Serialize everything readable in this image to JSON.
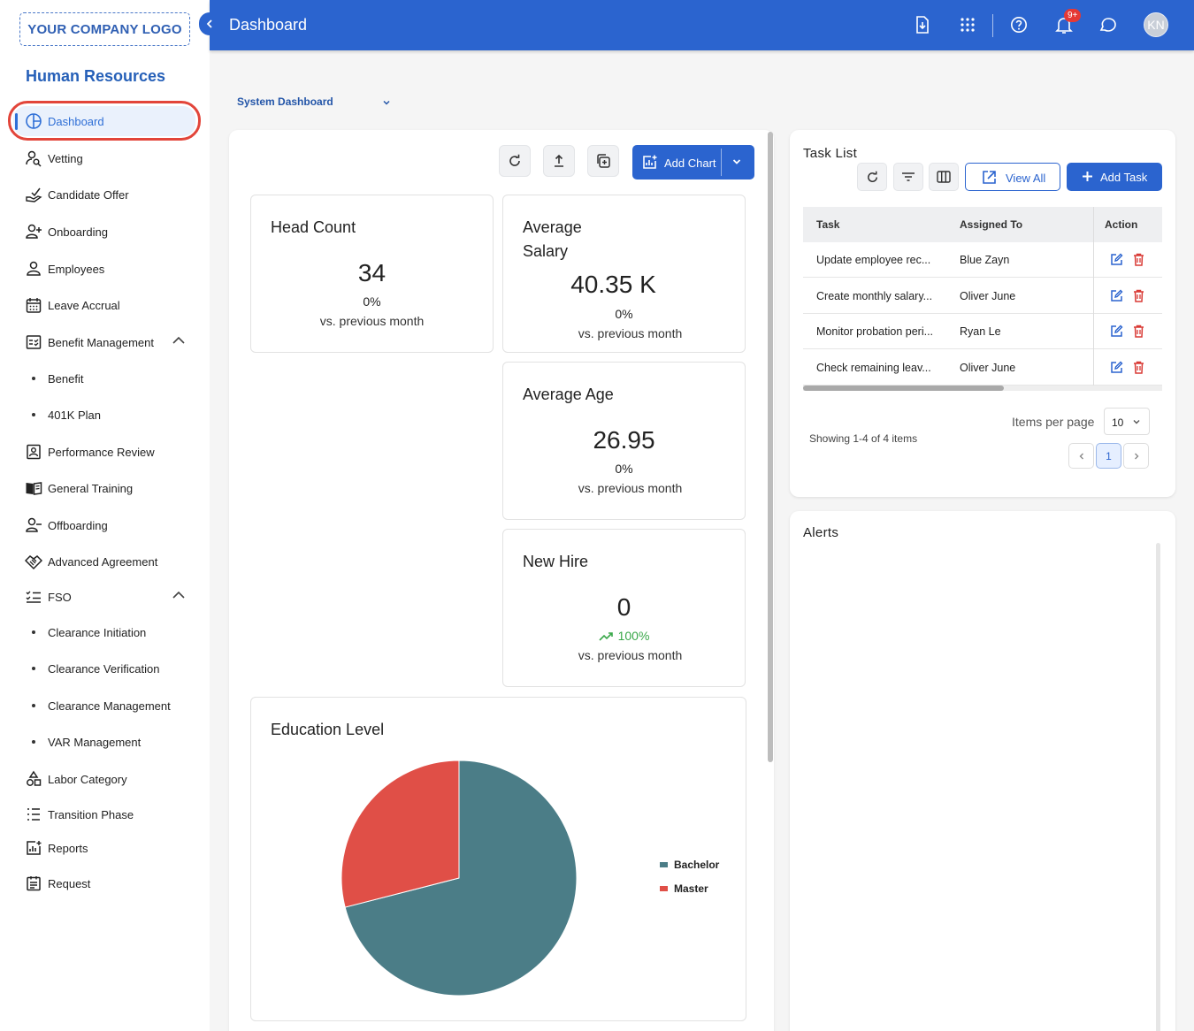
{
  "logo": {
    "text": "YOUR COMPANY LOGO"
  },
  "sidebar": {
    "section_title": "Human Resources",
    "items": [
      {
        "label": "Dashboard",
        "icon": "pie-chart-icon",
        "active": true
      },
      {
        "label": "Vetting",
        "icon": "person-search-icon"
      },
      {
        "label": "Candidate Offer",
        "icon": "hand-offer-icon"
      },
      {
        "label": "Onboarding",
        "icon": "person-add-icon"
      },
      {
        "label": "Employees",
        "icon": "person-icon"
      },
      {
        "label": "Leave Accrual",
        "icon": "calendar-icon"
      },
      {
        "label": "Benefit Management",
        "icon": "checklist-icon",
        "expanded": true
      },
      {
        "label": "Benefit",
        "sub": true
      },
      {
        "label": "401K Plan",
        "sub": true
      },
      {
        "label": "Performance Review",
        "icon": "review-icon"
      },
      {
        "label": "General Training",
        "icon": "book-icon"
      },
      {
        "label": "Offboarding",
        "icon": "person-remove-icon"
      },
      {
        "label": "Advanced Agreement",
        "icon": "handshake-icon"
      },
      {
        "label": "FSO",
        "icon": "task-list-icon",
        "expanded": true
      },
      {
        "label": "Clearance Initiation",
        "sub": true
      },
      {
        "label": "Clearance Verification",
        "sub": true
      },
      {
        "label": "Clearance Management",
        "sub": true
      },
      {
        "label": "VAR Management",
        "sub": true
      },
      {
        "label": "Labor Category",
        "icon": "category-icon"
      },
      {
        "label": "Transition Phase",
        "icon": "list-numbered-icon"
      },
      {
        "label": "Reports",
        "icon": "report-chart-icon"
      },
      {
        "label": "Request",
        "icon": "request-doc-icon"
      }
    ]
  },
  "topbar": {
    "title": "Dashboard",
    "notification_count": "9+",
    "avatar_initials": "KN"
  },
  "dashboard_select": {
    "value": "System Dashboard"
  },
  "toolbar": {
    "add_chart_label": "Add Chart"
  },
  "cards": {
    "head_count": {
      "title": "Head Count",
      "value": "34",
      "change": "0%",
      "compare": "vs. previous month"
    },
    "avg_salary": {
      "title": "Average Salary",
      "value": "40.35 K",
      "change": "0%",
      "compare": "vs. previous month"
    },
    "avg_age": {
      "title": "Average Age",
      "value": "26.95",
      "change": "0%",
      "compare": "vs. previous month"
    },
    "new_hire": {
      "title": "New Hire",
      "value": "0",
      "change": "100%",
      "compare": "vs. previous month"
    }
  },
  "education": {
    "title": "Education Level"
  },
  "chart_data": {
    "type": "pie",
    "title": "Education Level",
    "categories": [
      "Bachelor",
      "Master"
    ],
    "values": [
      71,
      29
    ],
    "colors": [
      "#4b7d87",
      "#e04f47"
    ],
    "legend_position": "right"
  },
  "task_list": {
    "title": "Task List",
    "view_all_label": "View All",
    "add_task_label": "Add Task",
    "columns": [
      "Task",
      "Assigned To",
      "Action"
    ],
    "rows": [
      {
        "task": "Update employee rec...",
        "assigned": "Blue Zayn"
      },
      {
        "task": "Create monthly salary...",
        "assigned": "Oliver June"
      },
      {
        "task": "Monitor probation peri...",
        "assigned": "Ryan Le"
      },
      {
        "task": "Check remaining leav...",
        "assigned": "Oliver June"
      }
    ],
    "showing": "Showing 1-4 of 4 items",
    "items_per_page_label": "Items per page",
    "items_per_page": "10",
    "current_page": "1"
  },
  "alerts": {
    "title": "Alerts"
  }
}
